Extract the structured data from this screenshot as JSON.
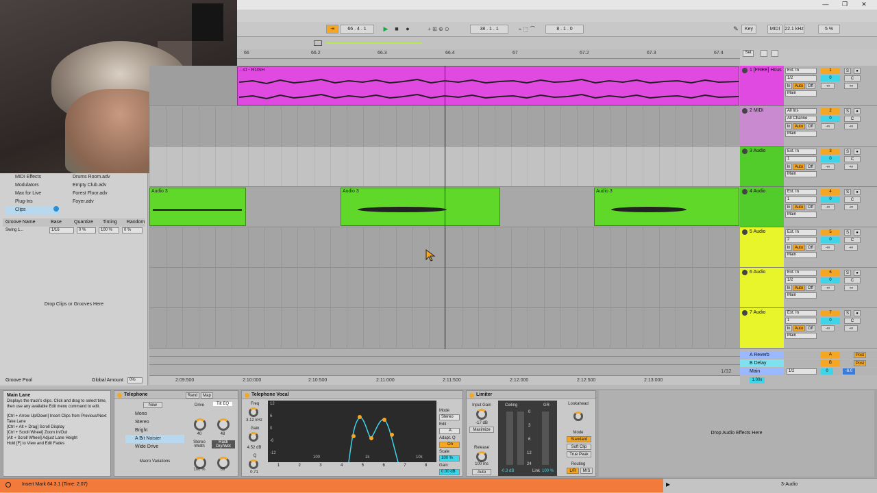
{
  "transport": {
    "arrangement_position": "66 . 4 . 1",
    "loop_start": "38 . 1 . 1",
    "loop_length": "8 . 1 . 0",
    "key_label": "Key",
    "midi_label": "MIDI",
    "sample_rate": "22.1 kHz",
    "cpu": "5 %"
  },
  "ruler": {
    "bars": [
      "66",
      "66.2",
      "66.3",
      "66.4",
      "67",
      "67.2",
      "67.3",
      "67.4"
    ],
    "set_label": "Set"
  },
  "browser": {
    "places": [
      "MIDI Effects",
      "Modulators",
      "Max for Live",
      "Plug-Ins",
      "Clips"
    ],
    "files": [
      "Drums Room.adv",
      "Empty Club.adv",
      "Forest Floor.adv",
      "Foyer.adv"
    ],
    "groove_headers": [
      "Groove Name",
      "Base",
      "Quantize",
      "Timing",
      "Random"
    ],
    "groove_row": {
      "name": "Swing 1...",
      "base": "1/16",
      "quantize": "0 %",
      "timing": "100 %",
      "random": "0 %"
    },
    "drop_text": "Drop Clips or Grooves Here",
    "groove_pool": "Groove Pool",
    "global_amount_label": "Global Amount",
    "global_amount": "0%"
  },
  "tracks": [
    {
      "num": "1",
      "name": "1 [FREE] Hous",
      "color": "#e04ae0",
      "input": "Ext. In",
      "channel": "1/2",
      "vol": "0",
      "pan": "C",
      "send": "-∞",
      "out": "Main"
    },
    {
      "num": "2",
      "name": "2 MIDI",
      "color": "#c98ad0",
      "input": "All Ins",
      "channel": "All Channe",
      "vol": "0",
      "pan": "C",
      "send": "-∞",
      "out": "Main"
    },
    {
      "num": "3",
      "name": "3 Audio",
      "color": "#52cc2a",
      "input": "Ext. In",
      "channel": "1",
      "vol": "0",
      "pan": "C",
      "send": "-∞",
      "out": "Main"
    },
    {
      "num": "4",
      "name": "4 Audio",
      "color": "#52cc2a",
      "input": "Ext. In",
      "channel": "1",
      "vol": "0",
      "pan": "C",
      "send": "-∞",
      "out": "Main"
    },
    {
      "num": "5",
      "name": "5 Audio",
      "color": "#e8f52a",
      "input": "Ext. In",
      "channel": "2",
      "vol": "0",
      "pan": "C",
      "send": "-∞",
      "out": "Main"
    },
    {
      "num": "6",
      "name": "6 Audio",
      "color": "#e8f52a",
      "input": "Ext. In",
      "channel": "1/2",
      "vol": "0",
      "pan": "C",
      "send": "-∞",
      "out": "Main"
    },
    {
      "num": "7",
      "name": "7 Audio",
      "color": "#e8f52a",
      "input": "Ext. In",
      "channel": "1",
      "vol": "0",
      "pan": "C",
      "send": "-∞",
      "out": "Main"
    }
  ],
  "returns": [
    {
      "letter": "A",
      "name": "A Reverb",
      "color": "#9ab8ff",
      "post": "Post"
    },
    {
      "letter": "B",
      "name": "B Delay",
      "color": "#7fe0f0",
      "post": "Post"
    }
  ],
  "master": {
    "name": "Main",
    "channel": "1/2",
    "vol": "0",
    "db": "-6.0",
    "zoom": "1.00x",
    "scale": "1/32"
  },
  "clips": {
    "track1_label": "...st - RUSH",
    "track4_label": "Audio 3"
  },
  "timeline": [
    "2:09:500",
    "2:10:000",
    "2:10:500",
    "2:11:000",
    "2:11:500",
    "2:12:000",
    "2:12:500",
    "2:13:000"
  ],
  "info": {
    "title": "Main Lane",
    "body": "Displays the track's clips. Click and drag to select time, then use any available Edit menu command to edit.",
    "shortcuts": [
      "[Ctrl + Arrow Up/Down] Insert Clips from Previous/Next Take Lane",
      "[Ctrl + Alt + Drag] Scroll Display",
      "[Ctrl + Scroll Wheel] Zoom In/Out",
      "[Alt + Scroll Wheel] Adjust Lane Height",
      "Hold [F] to View and Edit Fades"
    ]
  },
  "rack": {
    "title": "Telephone",
    "buttons": [
      "Rand",
      "Map"
    ],
    "new_label": "New",
    "chains": [
      "Mono",
      "Stereo",
      "Bright",
      "A Bit Noisier",
      "Wide Drive"
    ],
    "drive_label": "Drive",
    "drive_value": "40",
    "tilt_label": "Tilt EQ",
    "tilt_value": "48",
    "stereo_label": "Stereo Width",
    "stereo_value": "100 %",
    "rack_label": "Rack Dry/Wet",
    "rack_value": "69",
    "macro_label": "Macro Variations"
  },
  "eq": {
    "title": "Telephone Vocal",
    "freq_label": "Freq",
    "freq_value": "3.12 kHz",
    "gain_label": "Gain",
    "gain_value": "4.52 dB",
    "q_label": "Q",
    "q_value": "0.71",
    "db_ticks": [
      "12",
      "6",
      "0",
      "-6",
      "-12"
    ],
    "hz_ticks": [
      "100",
      "1k",
      "10k"
    ],
    "mode_label": "Mode",
    "mode_value": "Stereo",
    "edit_label": "Edit",
    "edit_value": "A",
    "adapt_label": "Adapt. Q",
    "adapt_value": "On",
    "scale_label": "Scale",
    "scale_value": "100 %",
    "out_gain_label": "Gain",
    "out_gain_value": "0.00 dB",
    "bands": [
      "1",
      "2",
      "3",
      "4",
      "5",
      "6",
      "7",
      "8"
    ]
  },
  "limiter": {
    "title": "Limiter",
    "input_label": "Input Gain",
    "input_value": "-17 dB",
    "maximize": "Maximize",
    "release_label": "Release",
    "release_value": "100 ms",
    "auto": "Auto",
    "ceiling_label": "Ceiling",
    "ceiling_value": "-0.3 dB",
    "gr_label": "GR",
    "gr_ticks": [
      "0",
      "3",
      "6",
      "12",
      "24"
    ],
    "link_label": "Link",
    "link_value": "100 %",
    "lookahead_label": "Lookahead",
    "mode_label": "Mode",
    "modes": [
      "Standard",
      "Soft Clip",
      "True Peak"
    ],
    "routing_label": "Routing",
    "routing": [
      "L/R",
      "M/S"
    ]
  },
  "drop_effects": "Drop Audio Effects Here",
  "status": {
    "message": "Insert Mark 64.3.1 (Time: 2:07)",
    "track": "3-Audio"
  },
  "colors": {
    "accent": "#f5a623",
    "status_bar": "#f27a3a",
    "cyan": "#3fd5e8"
  },
  "icons": [
    "play-icon",
    "stop-icon",
    "record-icon",
    "close-icon",
    "maximize-icon",
    "minimize-icon",
    "cursor-icon"
  ]
}
